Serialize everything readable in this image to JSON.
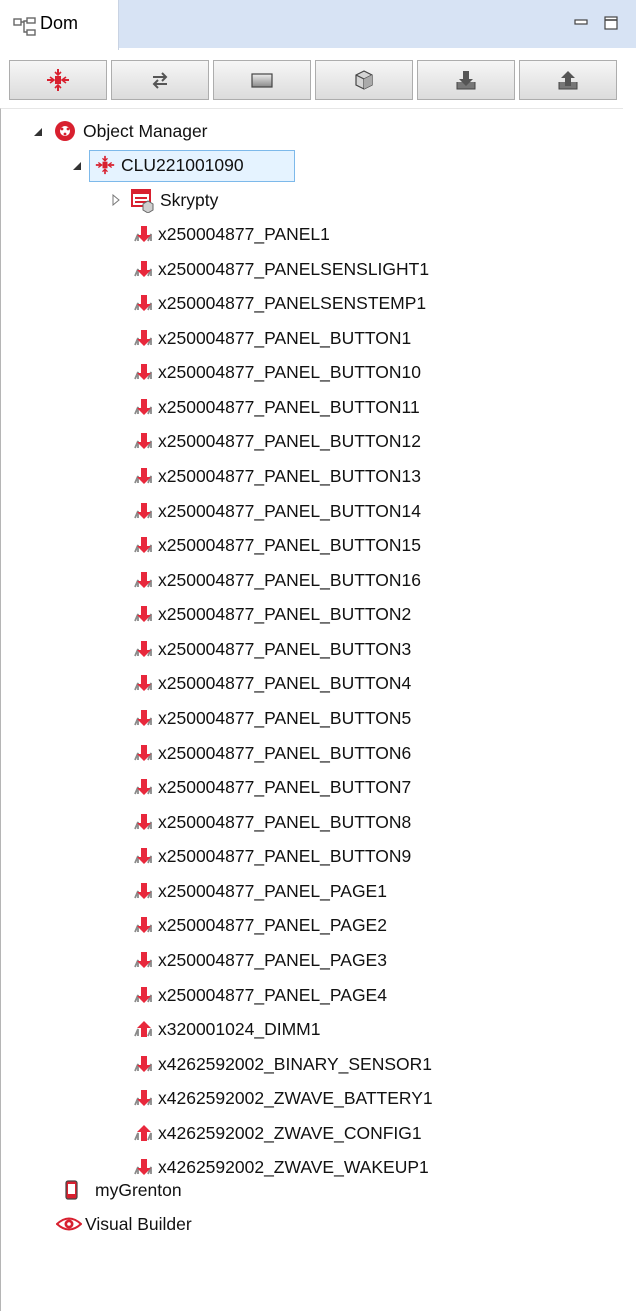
{
  "tab": {
    "title": "Dom",
    "icon": "tree-structure-icon"
  },
  "window_controls": [
    {
      "name": "minimize-button",
      "icon": "minimize-icon"
    },
    {
      "name": "maximize-button",
      "icon": "maximize-icon"
    }
  ],
  "toolbar": [
    {
      "name": "toolbar-clu-button",
      "icon": "clu-icon"
    },
    {
      "name": "toolbar-swap-button",
      "icon": "swap-arrows-icon"
    },
    {
      "name": "toolbar-panel-button",
      "icon": "rectangle-icon"
    },
    {
      "name": "toolbar-object-button",
      "icon": "cube-icon"
    },
    {
      "name": "toolbar-import-button",
      "icon": "import-icon"
    },
    {
      "name": "toolbar-export-button",
      "icon": "export-icon"
    }
  ],
  "tree": {
    "root": {
      "label": "Object Manager",
      "icon": "object-manager-icon",
      "expanded": true
    },
    "clu": {
      "label": "CLU221001090",
      "icon": "clu-icon",
      "expanded": true,
      "selected": true
    },
    "scripts": {
      "label": "Skrypty",
      "icon": "scripts-icon",
      "expanded": false
    },
    "objects": [
      {
        "label": "x250004877_PANEL1",
        "icon": "input-arrow-icon"
      },
      {
        "label": "x250004877_PANELSENSLIGHT1",
        "icon": "input-arrow-icon"
      },
      {
        "label": "x250004877_PANELSENSTEMP1",
        "icon": "input-arrow-icon"
      },
      {
        "label": "x250004877_PANEL_BUTTON1",
        "icon": "input-arrow-icon"
      },
      {
        "label": "x250004877_PANEL_BUTTON10",
        "icon": "input-arrow-icon"
      },
      {
        "label": "x250004877_PANEL_BUTTON11",
        "icon": "input-arrow-icon"
      },
      {
        "label": "x250004877_PANEL_BUTTON12",
        "icon": "input-arrow-icon"
      },
      {
        "label": "x250004877_PANEL_BUTTON13",
        "icon": "input-arrow-icon"
      },
      {
        "label": "x250004877_PANEL_BUTTON14",
        "icon": "input-arrow-icon"
      },
      {
        "label": "x250004877_PANEL_BUTTON15",
        "icon": "input-arrow-icon"
      },
      {
        "label": "x250004877_PANEL_BUTTON16",
        "icon": "input-arrow-icon"
      },
      {
        "label": "x250004877_PANEL_BUTTON2",
        "icon": "input-arrow-icon"
      },
      {
        "label": "x250004877_PANEL_BUTTON3",
        "icon": "input-arrow-icon"
      },
      {
        "label": "x250004877_PANEL_BUTTON4",
        "icon": "input-arrow-icon"
      },
      {
        "label": "x250004877_PANEL_BUTTON5",
        "icon": "input-arrow-icon"
      },
      {
        "label": "x250004877_PANEL_BUTTON6",
        "icon": "input-arrow-icon"
      },
      {
        "label": "x250004877_PANEL_BUTTON7",
        "icon": "input-arrow-icon"
      },
      {
        "label": "x250004877_PANEL_BUTTON8",
        "icon": "input-arrow-icon"
      },
      {
        "label": "x250004877_PANEL_BUTTON9",
        "icon": "input-arrow-icon"
      },
      {
        "label": "x250004877_PANEL_PAGE1",
        "icon": "input-arrow-icon"
      },
      {
        "label": "x250004877_PANEL_PAGE2",
        "icon": "input-arrow-icon"
      },
      {
        "label": "x250004877_PANEL_PAGE3",
        "icon": "input-arrow-icon"
      },
      {
        "label": "x250004877_PANEL_PAGE4",
        "icon": "input-arrow-icon"
      },
      {
        "label": "x320001024_DIMM1",
        "icon": "output-arrow-icon"
      },
      {
        "label": "x4262592002_BINARY_SENSOR1",
        "icon": "input-arrow-icon"
      },
      {
        "label": "x4262592002_ZWAVE_BATTERY1",
        "icon": "input-arrow-icon"
      },
      {
        "label": "x4262592002_ZWAVE_CONFIG1",
        "icon": "output-arrow-icon"
      },
      {
        "label": "x4262592002_ZWAVE_WAKEUP1",
        "icon": "input-arrow-icon"
      }
    ],
    "bottom": [
      {
        "label": "myGrenton",
        "icon": "phone-icon"
      },
      {
        "label": "Visual Builder",
        "icon": "eye-icon"
      }
    ]
  },
  "colors": {
    "accent_red": "#e8283c",
    "selection_bg": "#e5f3ff",
    "selection_border": "#7db9ea",
    "tab_strip": "#d7e3f4"
  }
}
